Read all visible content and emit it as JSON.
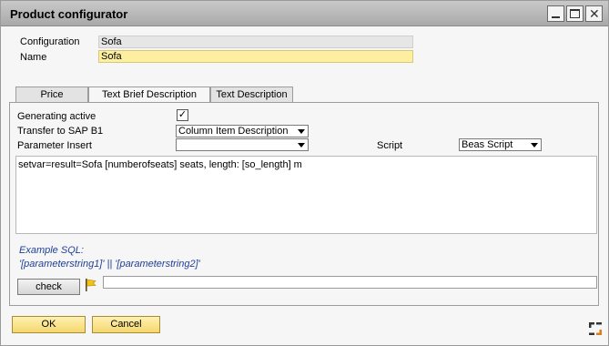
{
  "window": {
    "title": "Product configurator",
    "controls": {
      "minimize": "minimize-icon",
      "maximize": "maximize-icon",
      "close": "close-icon"
    }
  },
  "header": {
    "configuration_label": "Configuration",
    "configuration_value": "Sofa",
    "name_label": "Name",
    "name_value": "Sofa"
  },
  "tabs": [
    {
      "label": "Price",
      "active": false
    },
    {
      "label": "Text Brief Description",
      "active": true
    },
    {
      "label": "Text Description",
      "active": false
    }
  ],
  "form": {
    "generating_active_label": "Generating active",
    "generating_active_checked": true,
    "check_mark": "✓",
    "transfer_label": "Transfer to SAP B1",
    "transfer_value": "Column Item Description",
    "parameter_insert_label": "Parameter Insert",
    "parameter_insert_value": "",
    "script_label": "Script",
    "script_value": "Beas Script",
    "script_text": "setvar=result=Sofa  [numberofseats] seats, length: [so_length] m"
  },
  "example": {
    "line1": "Example SQL:",
    "line2": "'[parameterstring1]'  ||  '[parameterstring2]'"
  },
  "check_button": "check",
  "check_result": "",
  "footer": {
    "ok_label": "OK",
    "cancel_label": "Cancel"
  },
  "colors": {
    "title_gradient_top": "#c9c9c9",
    "accent_yellow": "#fcf0a0",
    "sql_blue": "#1f3f99"
  }
}
